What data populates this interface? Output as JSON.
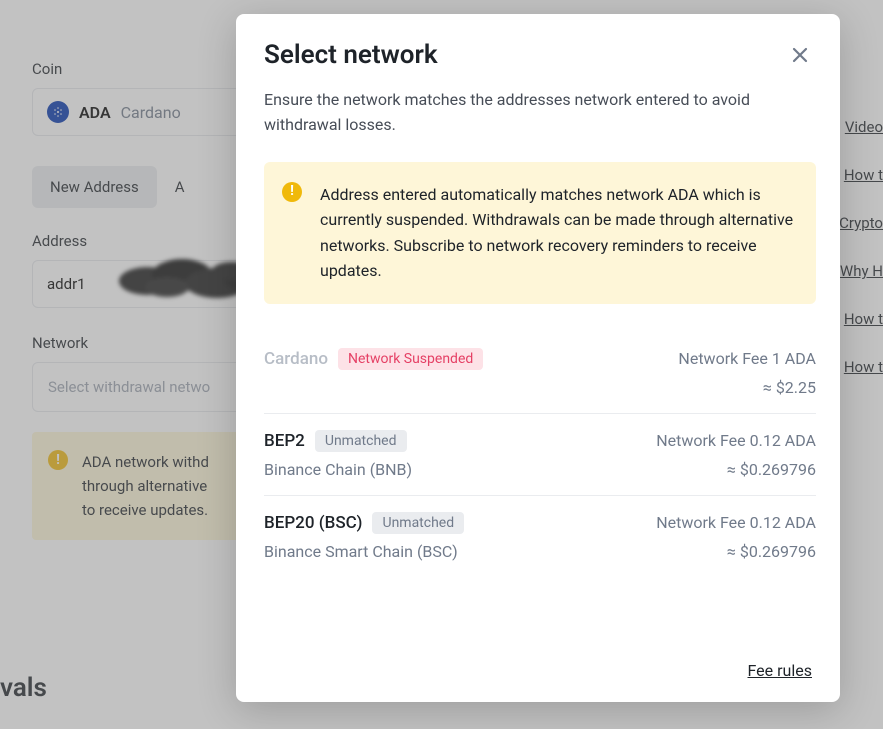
{
  "background": {
    "coinLabel": "Coin",
    "coinSymbol": "ADA",
    "coinName": "Cardano",
    "tabNewAddress": "New Address",
    "tabOther": "A",
    "addressLabel": "Address",
    "addressValue": "addr1",
    "networkLabel": "Network",
    "networkPlaceholder": "Select withdrawal netwo",
    "warnText": "ADA network withd through alternative to receive updates.",
    "heading": "vals"
  },
  "sideLinks": {
    "l1": "Video",
    "l2": "How t",
    "l3": "Crypto",
    "l4": "Why H",
    "l5": "How t",
    "l6": "How t"
  },
  "modal": {
    "title": "Select network",
    "description": "Ensure the network matches the addresses network entered to avoid withdrawal losses.",
    "alert": "Address entered automatically matches network ADA which is currently suspended. Withdrawals can be made through alternative networks. Subscribe to network recovery reminders to receive updates.",
    "networks": [
      {
        "name": "Cardano",
        "sub": "",
        "badge": "Network Suspended",
        "badgeType": "suspended",
        "fee": "Network Fee 1 ADA",
        "approx": "≈ $2.25",
        "disabled": true
      },
      {
        "name": "BEP2",
        "sub": "Binance Chain (BNB)",
        "badge": "Unmatched",
        "badgeType": "unmatched",
        "fee": "Network Fee 0.12 ADA",
        "approx": "≈ $0.269796",
        "disabled": false
      },
      {
        "name": "BEP20 (BSC)",
        "sub": "Binance Smart Chain (BSC)",
        "badge": "Unmatched",
        "badgeType": "unmatched",
        "fee": "Network Fee 0.12 ADA",
        "approx": "≈ $0.269796",
        "disabled": false
      }
    ],
    "feeRules": "Fee rules"
  }
}
